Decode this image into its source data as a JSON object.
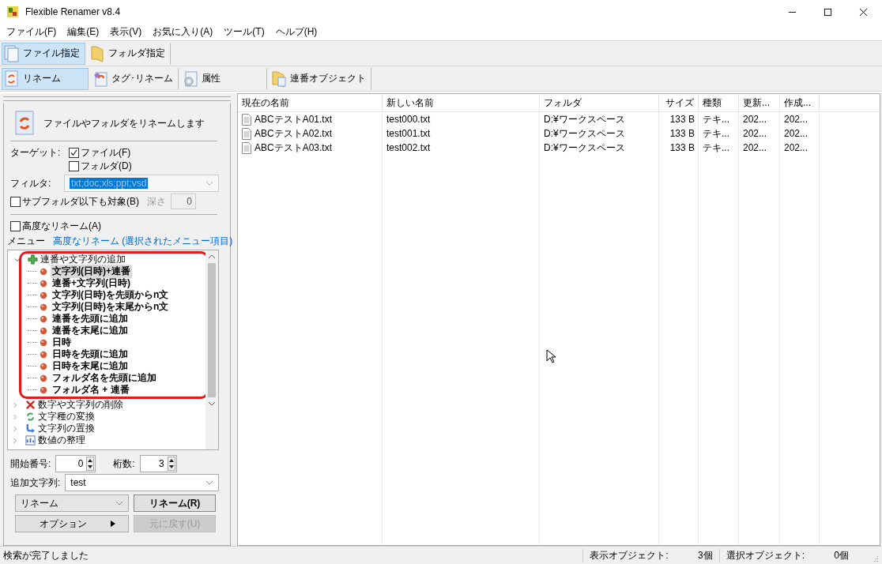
{
  "window": {
    "title": "Flexible Renamer v8.4"
  },
  "menu_bar": [
    "ファイル(F)",
    "編集(E)",
    "表示(V)",
    "お気に入り(A)",
    "ツール(T)",
    "ヘルプ(H)"
  ],
  "mode_tabs": [
    {
      "label": "ファイル指定",
      "selected": true,
      "kind": "file"
    },
    {
      "label": "フォルダ指定",
      "selected": false,
      "kind": "folder"
    }
  ],
  "function_tabs": [
    {
      "label": "リネーム",
      "selected": true,
      "kind": "rename"
    },
    {
      "label": "タグ･リネーム",
      "selected": false,
      "kind": "tag"
    },
    {
      "label": "属性",
      "selected": false,
      "kind": "attr"
    },
    {
      "label": "連番オブジェクト",
      "selected": false,
      "kind": "serial"
    }
  ],
  "left_panel": {
    "heading": "ファイルやフォルダをリネームします",
    "target_label": "ターゲット:",
    "targets": [
      {
        "label": "ファイル(F)",
        "checked": true
      },
      {
        "label": "フォルダ(D)",
        "checked": false
      }
    ],
    "filter_label": "フィルタ:",
    "filter_value": "txt;doc;xls;ppt;vsd",
    "subfolder": {
      "label": "サブフォルダ以下も対象(B)",
      "checked": false
    },
    "depth_label": "深さ",
    "depth_value": "0",
    "advanced": {
      "label": "高度なリネーム(A)",
      "checked": false
    },
    "menu_label": "メニュー",
    "menu_link": "高度なリネーム (選択されたメニュー項目)",
    "tree": [
      {
        "label": "連番や文字列の追加",
        "kind": "add",
        "expanded": true,
        "children": [
          {
            "label": "文字列(日時)+連番",
            "selected": true
          },
          {
            "label": "連番+文字列(日時)",
            "selected": false
          },
          {
            "label": "文字列(日時)を先頭からn文",
            "selected": false
          },
          {
            "label": "文字列(日時)を末尾からn文",
            "selected": false
          },
          {
            "label": "連番を先頭に追加",
            "selected": false
          },
          {
            "label": "連番を末尾に追加",
            "selected": false
          },
          {
            "label": "日時",
            "selected": false
          },
          {
            "label": "日時を先頭に追加",
            "selected": false
          },
          {
            "label": "日時を末尾に追加",
            "selected": false
          },
          {
            "label": "フォルダ名を先頭に追加",
            "selected": false
          },
          {
            "label": "フォルダ名 + 連番",
            "selected": false
          }
        ]
      },
      {
        "label": "数字や文字列の削除",
        "kind": "delete",
        "expanded": false
      },
      {
        "label": "文字種の変換",
        "kind": "convert",
        "expanded": false
      },
      {
        "label": "文字列の置換",
        "kind": "replace",
        "expanded": false
      },
      {
        "label": "数値の整理",
        "kind": "number",
        "expanded": false
      }
    ],
    "start_label": "開始番号:",
    "start_value": "0",
    "digits_label": "桁数:",
    "digits_value": "3",
    "append_label": "追加文字列:",
    "append_value": "test",
    "mode_select": "リネーム",
    "rename_button": "リネーム(R)",
    "options_button": "オプション",
    "undo_button": {
      "label": "元に戻す(U)",
      "disabled": true
    }
  },
  "file_list": {
    "columns": [
      "現在の名前",
      "新しい名前",
      "フォルダ",
      "サイズ",
      "種類",
      "更新...",
      "作成..."
    ],
    "rows": [
      [
        "ABCテストA01.txt",
        "test000.txt",
        "D:¥ワークスペース",
        "133 B",
        "テキ...",
        "202...",
        "202..."
      ],
      [
        "ABCテストA02.txt",
        "test001.txt",
        "D:¥ワークスペース",
        "133 B",
        "テキ...",
        "202...",
        "202..."
      ],
      [
        "ABCテストA03.txt",
        "test002.txt",
        "D:¥ワークスペース",
        "133 B",
        "テキ...",
        "202...",
        "202..."
      ]
    ]
  },
  "status_bar": {
    "message": "検索が完了しました",
    "shown_label": "表示オブジェクト:",
    "shown_count": "3個",
    "selected_label": "選択オブジェクト:",
    "selected_count": "0個"
  }
}
